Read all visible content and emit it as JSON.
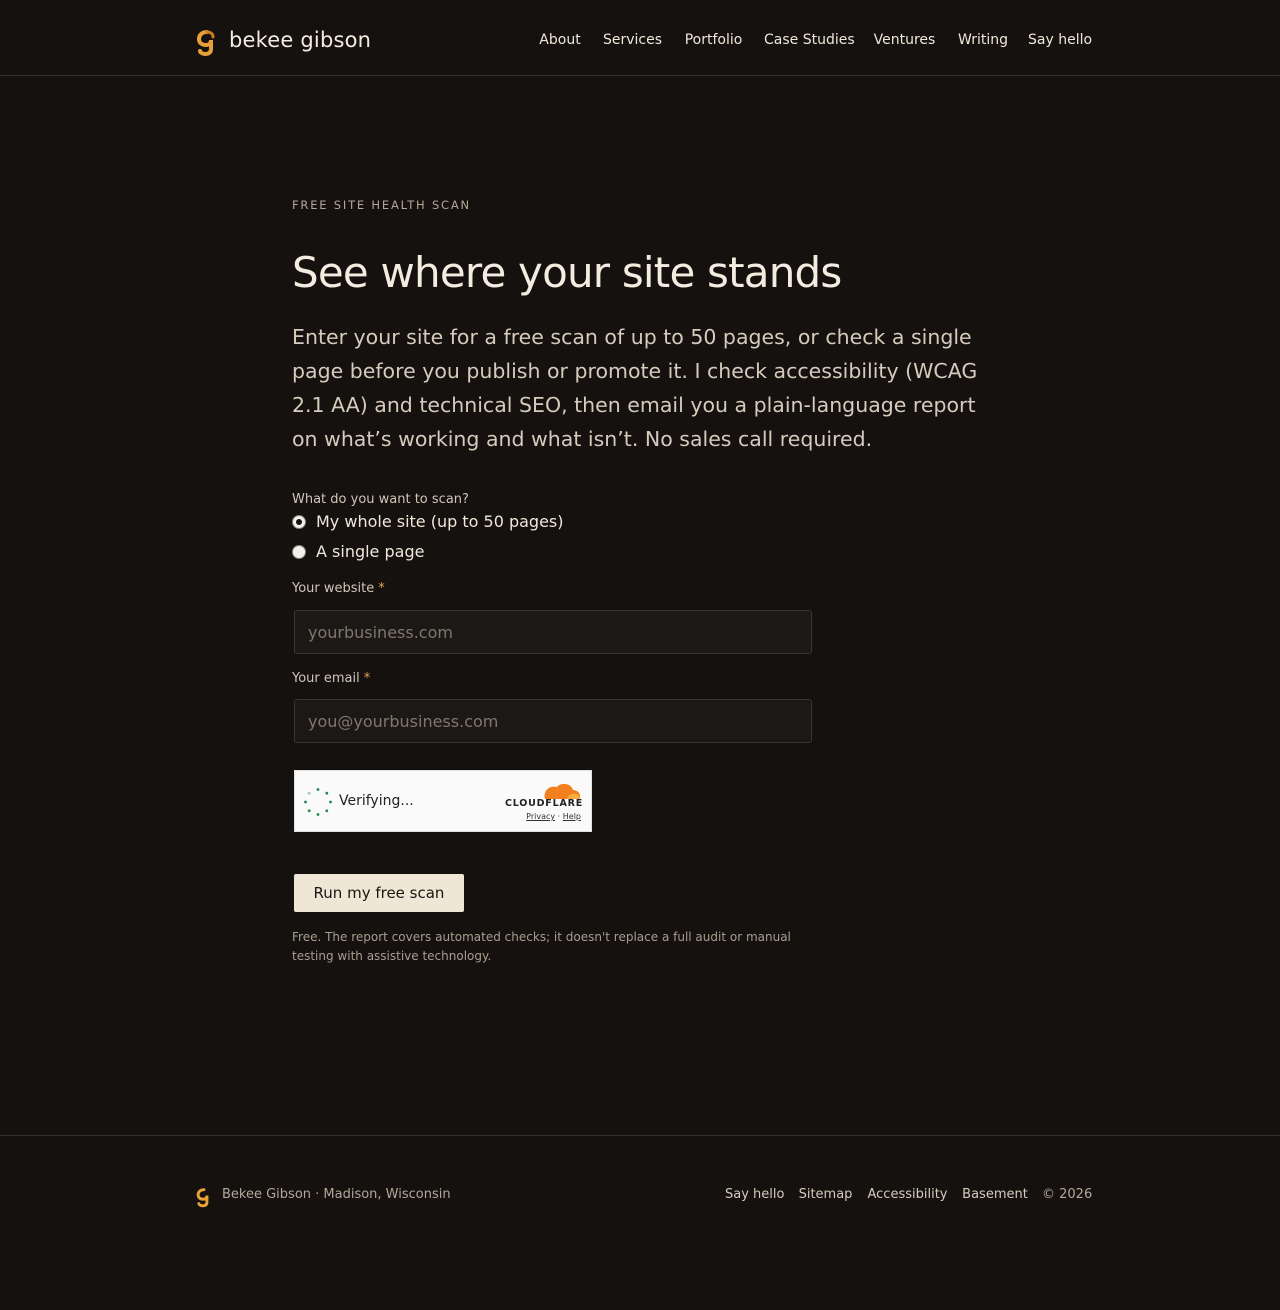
{
  "header": {
    "skip_link": "",
    "brand_name": "bekee gibson",
    "nav": [
      {
        "label": "About"
      },
      {
        "label": "Services"
      },
      {
        "label": "Portfolio"
      },
      {
        "label": "Case Studies"
      },
      {
        "label": "Ventures"
      },
      {
        "label": "Writing"
      },
      {
        "label": "Say hello"
      }
    ]
  },
  "main": {
    "eyebrow": "Free site health scan",
    "title": "See where your site stands",
    "intro": "Enter your site for a free scan of up to 50 pages, or check a single page before you publish or promote it. I check accessibility (WCAG 2.1 AA) and technical SEO, then email you a plain-language report on what’s working and what isn’t. No sales call required.",
    "scan_question": "What do you want to scan?",
    "options": [
      {
        "label": "My whole site (up to 50 pages)",
        "selected": true
      },
      {
        "label": "A single page",
        "selected": false
      }
    ],
    "website": {
      "label": "Your website",
      "required_mark": "*",
      "placeholder": "yourbusiness.com",
      "value": ""
    },
    "email": {
      "label": "Your email",
      "required_mark": "*",
      "placeholder": "you@yourbusiness.com",
      "value": ""
    },
    "captcha": {
      "status": "Verifying...",
      "brand": "CLOUDFLARE",
      "privacy": "Privacy",
      "separator": "·",
      "help": "Help"
    },
    "submit_label": "Run my free scan",
    "disclaimer": "Free. The report covers automated checks; it doesn't replace a full audit or manual testing with assistive technology."
  },
  "footer": {
    "credit": "Bekee Gibson · Madison, Wisconsin",
    "links": [
      {
        "label": "Say hello"
      },
      {
        "label": "Sitemap"
      },
      {
        "label": "Accessibility"
      },
      {
        "label": "Basement"
      }
    ],
    "copyright": "© 2026"
  },
  "colors": {
    "background": "#15110e",
    "text": "#efe7da",
    "accent": "#e8a13a",
    "button_bg": "#efe6d6"
  },
  "icons": {
    "brand_logo": "bg-monogram-logo",
    "spinner": "loading-spinner-icon",
    "cloudflare": "cloudflare-cloud-icon"
  }
}
